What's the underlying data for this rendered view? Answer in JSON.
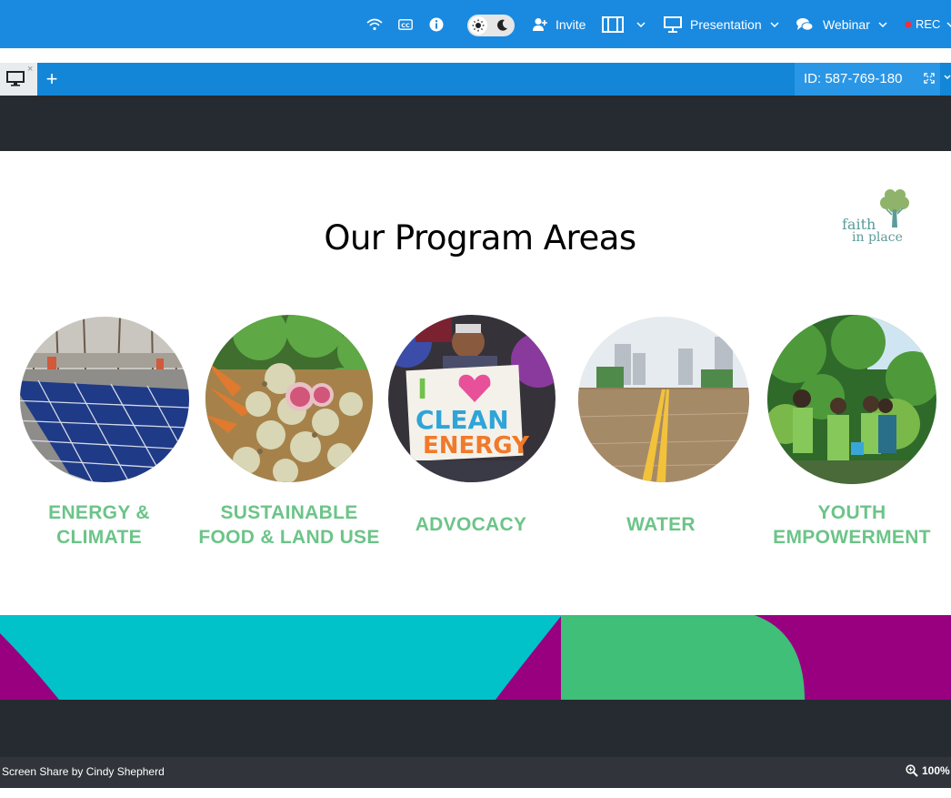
{
  "toolbar": {
    "icons": [
      "wifi-icon",
      "closed-caption-icon",
      "info-icon",
      "sun-icon",
      "moon-icon",
      "add-user-icon",
      "layout-icon",
      "chevron-down-icon",
      "presentation-icon",
      "chat-icon",
      "record-dot-icon"
    ],
    "invite_label": "Invite",
    "presentation_label": "Presentation",
    "webinar_label": "Webinar",
    "rec_label": "REC"
  },
  "tabs": {
    "add_label": "+",
    "close_label": "×",
    "session_id": "ID: 587-769-180"
  },
  "slide": {
    "title": "Our Program Areas",
    "logo_line1": "faith",
    "logo_line2": "in place",
    "programs": [
      {
        "label": "ENERGY &\nCLIMATE",
        "image": "solar-panels"
      },
      {
        "label": "SUSTAINABLE\nFOOD & LAND USE",
        "image": "radishes-basket"
      },
      {
        "label": "ADVOCACY",
        "image": "clean-energy-sign"
      },
      {
        "label": "WATER",
        "image": "flooded-street"
      },
      {
        "label": "YOUTH\nEMPOWERMENT",
        "image": "youth-planting"
      }
    ],
    "sign_text": [
      "I",
      "CLEAN",
      "ENERGY"
    ]
  },
  "status": {
    "share_text": "Screen Share by Cindy Shepherd",
    "zoom_text": "100%"
  },
  "colors": {
    "toolbar_bg": "#1a8ae0",
    "label_green": "#6cc488",
    "teal": "#00c2c8",
    "magenta": "#990080",
    "green": "#3fbf78",
    "stage_bg": "#262a31"
  }
}
